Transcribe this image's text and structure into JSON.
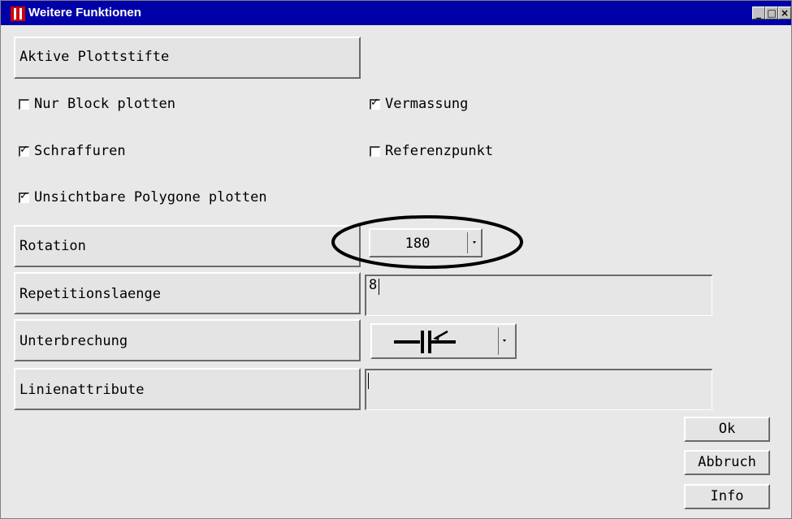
{
  "window": {
    "title": "Weitere Funktionen",
    "controls": [
      "_",
      "□",
      "×"
    ]
  },
  "aktive_plottstifte": {
    "label": "Aktive Plottstifte"
  },
  "checkboxes": {
    "nur_block": {
      "label": "Nur Block plotten",
      "checked": false
    },
    "vermassung": {
      "label": "Vermassung",
      "checked": true
    },
    "schraffuren": {
      "label": "Schraffuren",
      "checked": true
    },
    "referenzpunkt": {
      "label": "Referenzpunkt",
      "checked": false
    },
    "unsichtbare": {
      "label": "Unsichtbare Polygone plotten",
      "checked": true
    }
  },
  "rotation": {
    "label": "Rotation",
    "value": "180"
  },
  "repetitionslaenge": {
    "label": "Repetitionslaenge",
    "value": "8"
  },
  "unterbrechung": {
    "label": "Unterbrechung",
    "icon": "line-break-icon"
  },
  "linienattribute": {
    "label": "Linienattribute",
    "value": ""
  },
  "buttons": {
    "ok": "Ok",
    "abbruch": "Abbruch",
    "info": "Info"
  },
  "check_glyph": "✓",
  "colors": {
    "titlebar": "#0000a8",
    "highlight_ellipse": "#000000"
  }
}
